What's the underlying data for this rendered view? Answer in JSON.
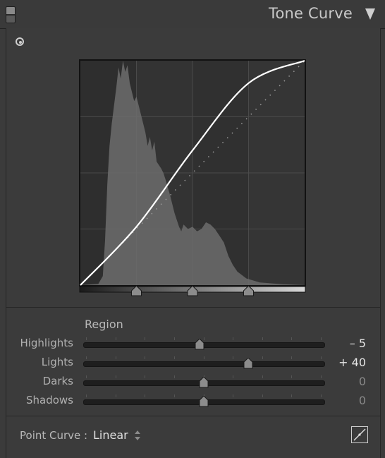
{
  "header": {
    "title": "Tone Curve"
  },
  "graph": {
    "curve_points": [
      [
        0,
        0
      ],
      [
        0.25,
        0.26
      ],
      [
        0.5,
        0.6
      ],
      [
        0.75,
        0.9
      ],
      [
        1,
        1
      ]
    ],
    "split_points": [
      0.25,
      0.5,
      0.75
    ]
  },
  "region": {
    "label": "Region",
    "sliders": [
      {
        "label": "Highlights",
        "value": "– 5",
        "level": 0.485,
        "dim": false
      },
      {
        "label": "Lights",
        "value": "+ 40",
        "level": 0.685,
        "dim": false
      },
      {
        "label": "Darks",
        "value": "0",
        "level": 0.5,
        "dim": true
      },
      {
        "label": "Shadows",
        "value": "0",
        "level": 0.5,
        "dim": true
      }
    ]
  },
  "point_curve": {
    "label": "Point Curve :",
    "value": "Linear"
  }
}
